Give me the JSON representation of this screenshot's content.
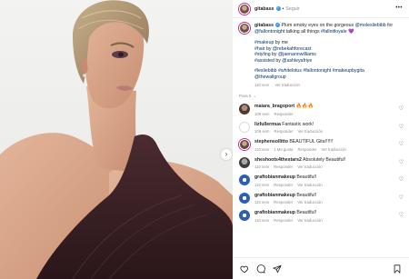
{
  "post": {
    "username": "gitabass",
    "follow_label": "Seguir",
    "dot": "•",
    "more_label": "•••",
    "caption": {
      "text_intro": "Plum smoky eyes on the gorgeous ",
      "mention_1": "@molesliebibb",
      "text_for": " for ",
      "mention_2": "@fallontonight",
      "text_talking": " talking all things ",
      "hashtag_1": "#fallnitloyale",
      "emoji": " 💜",
      "line_1": "#makeup",
      "line_1_suffix": " by me",
      "line_2": "#hair",
      "line_2_mid": " by ",
      "line_2_handle": "@rebekahforecast",
      "line_3": "#styling",
      "line_3_mid": " by ",
      "line_3_handle": "@jaenannwilliams",
      "line_4": "#assisted",
      "line_4_mid": " by ",
      "line_4_handle": "@ashleyafriye",
      "hashtags": "#lesliebibb #whitelotus #fallontonight #makeupbygita",
      "last_handle": "@thewallgroup",
      "time": "110 sem",
      "translate": "Ver traducción"
    },
    "para_ti": "Para ti",
    "para_ti_chevron": "⌄"
  },
  "comments": [
    {
      "user": "maiara_bragoport",
      "text": " 🔥🔥🔥",
      "time": "109 sem",
      "likes": "",
      "reply": "Responder",
      "translate": ""
    },
    {
      "user": "lizfullermua",
      "text": " Fantastic work!",
      "time": "109 sem",
      "likes": "",
      "reply": "Responder",
      "translate": "Ver traducción"
    },
    {
      "user": "stephensollitto",
      "text": " BEAUTIFUL Gita!!!!!!",
      "time": "110 sem",
      "likes": "1 Me gusta",
      "reply": "Responder",
      "translate": "Ver traducción"
    },
    {
      "user": "sheshoots4thestars2",
      "text": " Absolutely Beautiful!",
      "time": "110 sem",
      "likes": "",
      "reply": "Responder",
      "translate": "Ver traducción"
    },
    {
      "user": "graftobianmakeup",
      "text": " Beautiful!",
      "time": "110 sem",
      "likes": "",
      "reply": "Responder",
      "translate": "Ver traducción"
    },
    {
      "user": "graftobianmakeup",
      "text": " Beautiful!",
      "time": "110 sem",
      "likes": "",
      "reply": "Responder",
      "translate": "Ver traducción"
    },
    {
      "user": "graftobianmakeup",
      "text": " Beautiful!",
      "time": "110 sem",
      "likes": "",
      "reply": "Responder",
      "translate": "Ver traducción"
    }
  ],
  "icons": {
    "next": "›",
    "heart": "♡",
    "verified": "✓"
  },
  "colors": {
    "link": "#00376b",
    "muted": "#8e8e8e",
    "verified": "#3897f0",
    "dress": "#3a2226"
  }
}
